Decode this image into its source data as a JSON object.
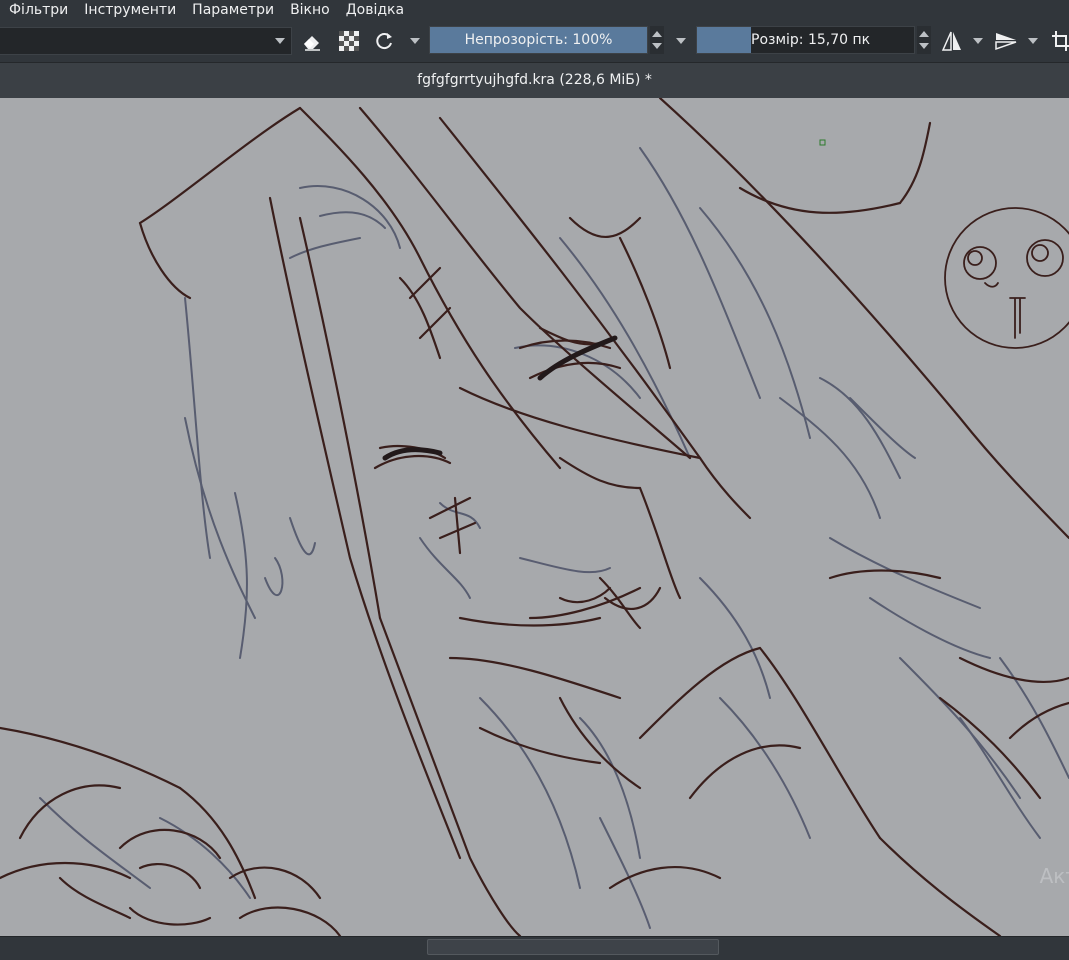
{
  "menu": {
    "items": [
      {
        "label": "Фільтри",
        "name": "menu-filters"
      },
      {
        "label": "Інструменти",
        "name": "menu-tools"
      },
      {
        "label": "Параметри",
        "name": "menu-settings"
      },
      {
        "label": "Вікно",
        "name": "menu-window"
      },
      {
        "label": "Довідка",
        "name": "menu-help"
      }
    ]
  },
  "toolbar": {
    "preset_value": "",
    "opacity_label": "Непрозорість: 100%",
    "opacity_fraction": 1.0,
    "size_label": "Розмір: 15,70 пк",
    "icons": [
      "eraser-icon",
      "alpha-lock-icon",
      "reload-preset-icon",
      "mirror-horizontal-icon",
      "mirror-vertical-icon",
      "crop-icon"
    ]
  },
  "document": {
    "title": "fgfgfgrrtyujhgfd.kra (228,6 МіБ) *"
  },
  "canvas": {
    "background": "#a7a9ac",
    "stroke_dark": "#3a1f1c",
    "stroke_blue": "#4b5066",
    "watermark": "Акт"
  },
  "colors": {
    "accent": "#5a7a9c",
    "ui_bg": "#31363b"
  }
}
